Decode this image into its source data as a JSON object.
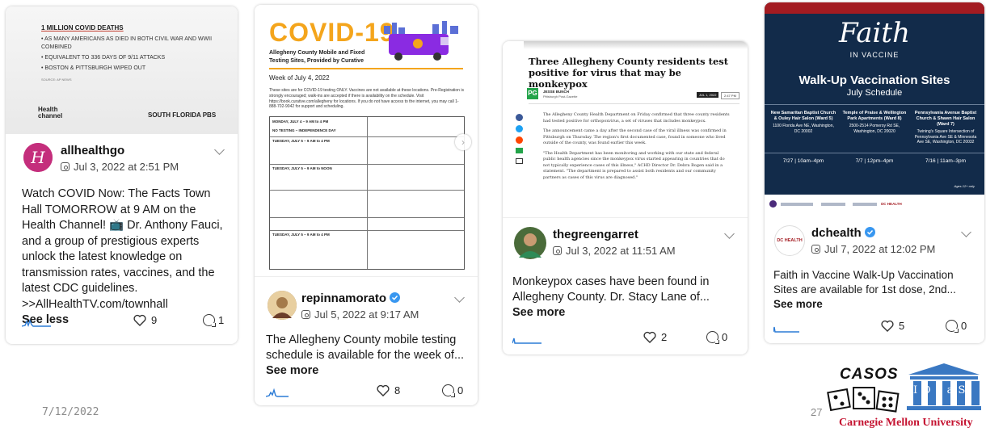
{
  "slide": {
    "date": "7/12/2022",
    "page_number": "27"
  },
  "logo": {
    "casos": "CASOS",
    "ideas": "I D e a S",
    "university": "Carnegie Mellon University"
  },
  "cards": [
    {
      "thumb": {
        "headline": "1 MILLION COVID DEATHS",
        "bullets": [
          "• AS MANY AMERICANS AS DIED IN BOTH CIVIL WAR AND WWII COMBINED",
          "• EQUIVALENT TO 336 DAYS OF 9/11 ATTACKS",
          "• BOSTON & PITTSBURGH WIPED OUT"
        ],
        "source": "SOURCE: AP NEWS",
        "brand_left": "Health channel",
        "brand_right": "SOUTH FLORIDA PBS"
      },
      "username": "allhealthgo",
      "timestamp": "Jul 3, 2022 at 2:51 PM",
      "text": "Watch COVID Now: The Facts Town Hall TOMORROW at 9 AM on the Health Channel! 📺 Dr. Anthony Fauci, and a group of prestigious experts unlock the latest knowledge on transmission rates, vaccines, and the latest CDC guidelines. >>AllHealthTV.com/townhall",
      "more": "See less",
      "likes": "9",
      "comments": "1"
    },
    {
      "thumb": {
        "title": "COVID-19",
        "subtitle": "Allegheny County Mobile and Fixed Testing Sites, Provided by Curative",
        "week": "Week of July 4, 2022",
        "para": "These sites are for COVID-19 testing ONLY. Vaccines are not available at these locations. Pre-Registration is strongly encouraged; walk-ins are accepted if there is availability on the schedule. Visit https://book.curative.com/allegheny for locations. If you do not have access to the internet, you may call 1-888-702-9042 for support and scheduling.",
        "rows": [
          "MONDAY, JULY 4 – 9 AM to 4 PM",
          "NO TESTING – INDEPENDENCE DAY",
          "TUESDAY, JULY 5 – 9 AM to 4 PM",
          "TUESDAY, JULY 5 – 9 AM to NOON",
          "TUESDAY, JULY 5 – 9 AM to 4 PM"
        ]
      },
      "username": "repinnamorato",
      "timestamp": "Jul 5, 2022 at 9:17 AM",
      "text": "The Allegheny County mobile testing schedule is available for the week of...",
      "more": "See more",
      "likes": "8",
      "comments": "0"
    },
    {
      "thumb": {
        "headline": "Three Allegheny County residents test positive for virus that may be monkeypox",
        "author": "JESSE BUNCH",
        "outlet": "Pittsburgh Post-Gazette",
        "date_tag": "JUL 1, 2022",
        "time_tag": "2:47 PM",
        "p1": "The Allegheny County Health Department on Friday confirmed that three county residents had tested positive for orthopoxvirus, a set of viruses that includes monkeypox.",
        "p2": "The announcement came a day after the second case of the viral illness was confirmed in Pittsburgh on Thursday. The region's first documented case, found in someone who lived outside of the county, was found earlier this week.",
        "p3": "\"The Health Department has been monitoring and working with our state and federal public health agencies since the monkeypox virus started appearing in countries that do not typically experience cases of this illness,\" ACHD Director Dr. Debra Bogen said in a statement. \"The department is prepared to assist both residents and our community partners as cases of this virus are diagnosed.\""
      },
      "username": "thegreengarret",
      "timestamp": "Jul 3, 2022 at 11:51 AM",
      "text": "Monkeypox cases have been found in Allegheny County. Dr. Stacy Lane of...",
      "more": "See more",
      "likes": "2",
      "comments": "0"
    },
    {
      "thumb": {
        "faith": "Faith",
        "in_vaccine": "IN VACCINE",
        "title": "Walk-Up Vaccination Sites",
        "subtitle": "July Schedule",
        "sites": [
          {
            "name": "New Samaritan Baptist Church & Ouley Hair Salon (Ward 5)",
            "addr": "1100 Florida Ave NE, Washington, DC 20002",
            "when": "7/27 | 10am–4pm"
          },
          {
            "name": "Temple of Praise & Wellington Park Apartments (Ward 8)",
            "addr": "2500-2514 Pomeroy Rd SE, Washington, DC 20020",
            "when": "7/7 | 12pm–4pm"
          },
          {
            "name": "Pennsylvania Avenue Baptist Church & Shawn Hair Salon (Ward 7)",
            "addr": "Twining's Square Intersection of Pennsylvania Ave SE & Minnesota Ave SE, Washington, DC 20032",
            "when": "7/16 | 11am–3pm"
          }
        ],
        "age": "Ages 12+ only",
        "sponsors": "DC HEALTH"
      },
      "username": "dchealth",
      "avatar_text": "DC HEALTH",
      "timestamp": "Jul 7, 2022 at 12:02 PM",
      "text": "Faith in Vaccine Walk-Up Vaccination Sites are available for 1st dose, 2nd...",
      "more": "See more",
      "likes": "5",
      "comments": "0"
    }
  ],
  "colors": {
    "covid_orange": "#f4a51c",
    "faith_navy": "#122b4a",
    "faith_red": "#a31b21",
    "verified_blue": "#3897f0",
    "spark_blue": "#2b7bd6",
    "cmu_red": "#c41230"
  }
}
